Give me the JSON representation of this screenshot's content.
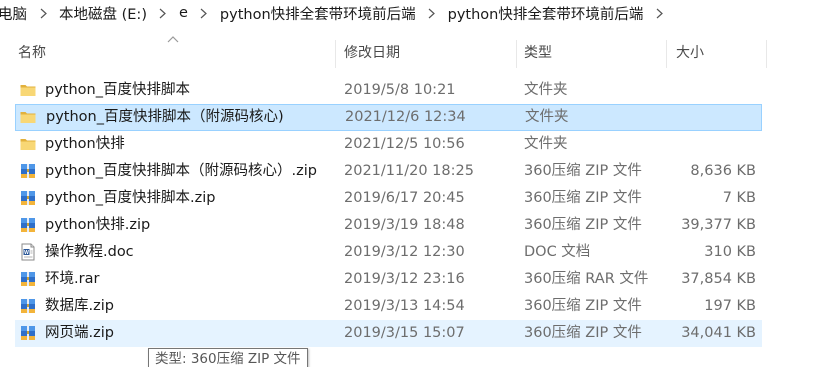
{
  "breadcrumb": [
    "电脑",
    "本地磁盘 (E:)",
    "e",
    "python快排全套带环境前后端",
    "python快排全套带环境前后端"
  ],
  "columns": {
    "name": "名称",
    "date": "修改日期",
    "type": "类型",
    "size": "大小"
  },
  "sort_indicator": "chevron-up-icon",
  "files": [
    {
      "name": "python_百度快排脚本",
      "date": "2019/5/8 10:21",
      "type": "文件夹",
      "size": "",
      "icon": "folder-icon",
      "state": "normal"
    },
    {
      "name": "python_百度快排脚本（附源码核心)",
      "date": "2021/12/6 12:34",
      "type": "文件夹",
      "size": "",
      "icon": "folder-icon",
      "state": "selected"
    },
    {
      "name": "python快排",
      "date": "2021/12/5 10:56",
      "type": "文件夹",
      "size": "",
      "icon": "folder-icon",
      "state": "normal"
    },
    {
      "name": "python_百度快排脚本（附源码核心）.zip",
      "date": "2021/11/20 18:25",
      "type": "360压缩 ZIP 文件",
      "size": "8,636 KB",
      "icon": "zip-archive-icon",
      "state": "normal"
    },
    {
      "name": "python_百度快排脚本.zip",
      "date": "2019/6/17 20:45",
      "type": "360压缩 ZIP 文件",
      "size": "7 KB",
      "icon": "zip-archive-icon",
      "state": "normal"
    },
    {
      "name": "python快排.zip",
      "date": "2019/3/19 18:48",
      "type": "360压缩 ZIP 文件",
      "size": "39,377 KB",
      "icon": "zip-archive-icon",
      "state": "normal"
    },
    {
      "name": "操作教程.doc",
      "date": "2019/3/12 12:30",
      "type": "DOC 文档",
      "size": "310 KB",
      "icon": "word-doc-icon",
      "state": "normal"
    },
    {
      "name": "环境.rar",
      "date": "2019/3/12 23:16",
      "type": "360压缩 RAR 文件",
      "size": "37,854 KB",
      "icon": "rar-archive-icon",
      "state": "normal"
    },
    {
      "name": "数据库.zip",
      "date": "2019/3/13 14:54",
      "type": "360压缩 ZIP 文件",
      "size": "197 KB",
      "icon": "zip-archive-icon",
      "state": "normal"
    },
    {
      "name": "网页端.zip",
      "date": "2019/3/15 15:07",
      "type": "360压缩 ZIP 文件",
      "size": "34,041 KB",
      "icon": "zip-archive-icon",
      "state": "hover"
    }
  ],
  "tooltip": "类型: 360压缩 ZIP 文件",
  "colors": {
    "selected_bg": "#cce8ff",
    "selected_border": "#99d1ff",
    "hover_bg": "#e5f3ff",
    "folder": "#f8d775",
    "archive_blue": "#2f6fc9"
  }
}
